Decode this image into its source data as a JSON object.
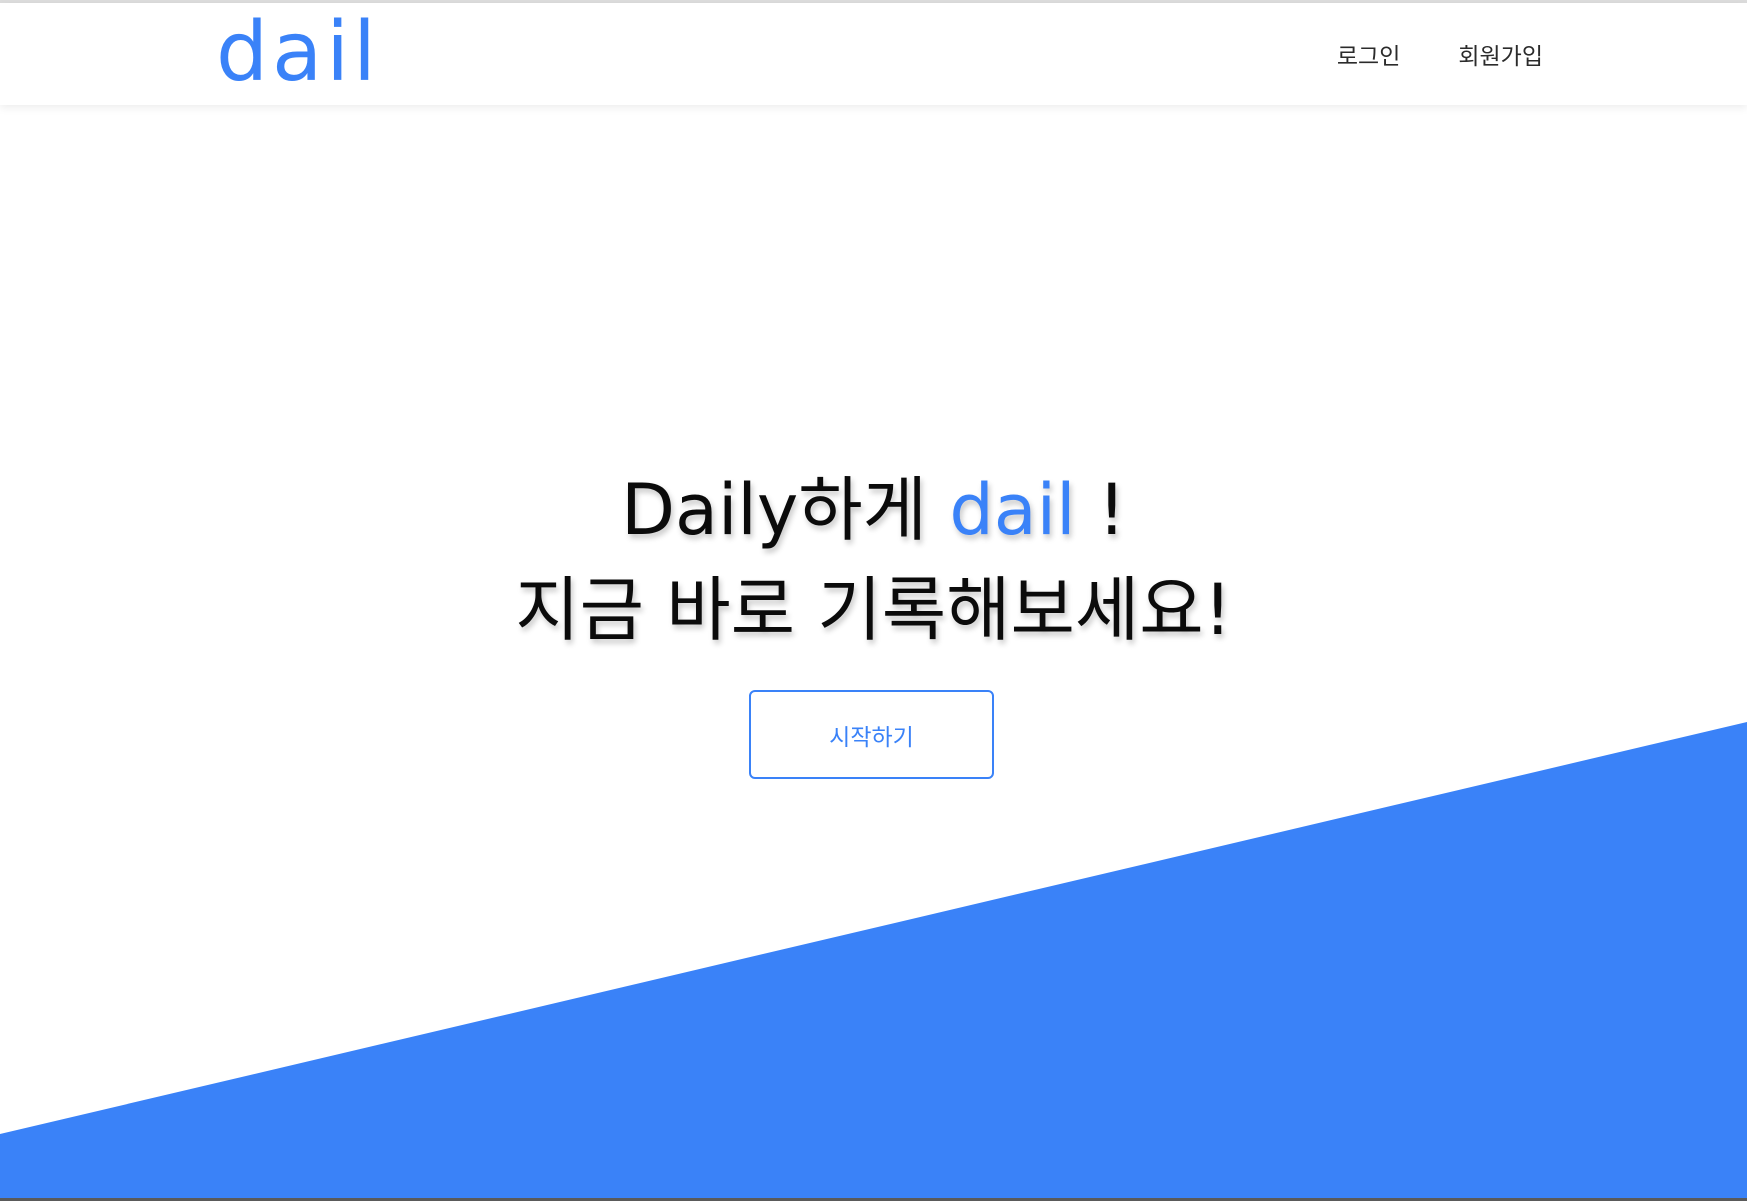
{
  "header": {
    "logo_text": "dail",
    "nav": [
      {
        "label": "로그인"
      },
      {
        "label": "회원가입"
      }
    ]
  },
  "hero": {
    "line1_prefix": "Daily하게 ",
    "line1_accent": "dail",
    "line1_suffix": " !",
    "line2": "지금 바로 기록해보세요!",
    "cta_label": "시작하기"
  },
  "colors": {
    "accent": "#3a82f8",
    "text": "#0b0b0b",
    "background": "#ffffff"
  }
}
